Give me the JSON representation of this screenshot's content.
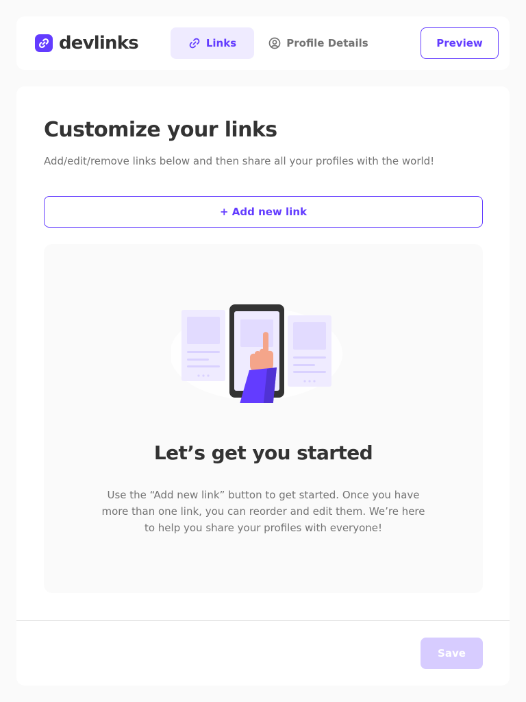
{
  "header": {
    "logo_text": "devlinks",
    "logo_icon": "link-logo-icon",
    "tabs": [
      {
        "label": "Links",
        "icon": "link-icon",
        "active": true
      },
      {
        "label": "Profile Details",
        "icon": "user-circle-icon",
        "active": false
      }
    ],
    "preview_label": "Preview"
  },
  "main": {
    "title": "Customize your links",
    "subtitle": "Add/edit/remove links below and then share all your profiles with the world!",
    "add_link_label": "+ Add new link",
    "empty_state": {
      "illustration": "phone-hand-illustration",
      "title": "Let’s get you started",
      "body": "Use the “Add new link” button to get started. Once you have more than one link, you can reorder and edit them. We’re here to help you share your profiles with everyone!"
    },
    "save_label": "Save"
  },
  "colors": {
    "accent": "#633CFF",
    "accent_light": "#EFEBFF",
    "accent_disabled": "#D7CCFF",
    "text_dark": "#333333",
    "text_gray": "#737373",
    "background": "#FAFAFA"
  }
}
